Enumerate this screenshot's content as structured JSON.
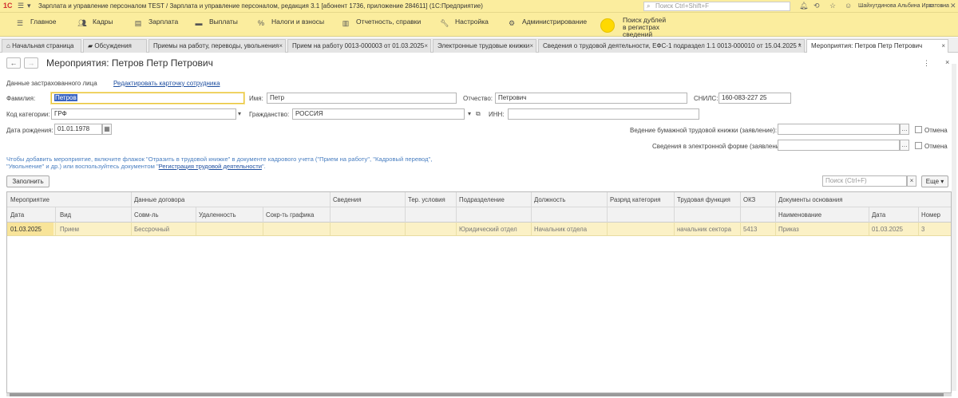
{
  "titlebar": {
    "logo": "1С",
    "title": "Зарплата и управление персоналом TEST / Зарплата и управление персоналом, редакция 3.1 [абонент 1736, приложение 284611] (1С:Предприятие)",
    "search_placeholder": "Поиск Ctrl+Shift+F",
    "user": "Шайхутдинова Альбина Ирхатовна"
  },
  "sections": {
    "main": "Главное",
    "staff": "Кадры",
    "salary": "Зарплата",
    "payments": "Выплаты",
    "taxes": "Налоги и взносы",
    "reports": "Отчетность, справки",
    "settings": "Настройка",
    "admin": "Администрирование",
    "dupes_line1": "Поиск дублей",
    "dupes_line2": "в регистрах сведений"
  },
  "tabs": [
    {
      "label": "Начальная страница"
    },
    {
      "label": "Обсуждения"
    },
    {
      "label": "Приемы на работу, переводы, увольнения"
    },
    {
      "label": "Прием на работу 0013-000003 от 01.03.2025"
    },
    {
      "label": "Электронные трудовые книжки"
    },
    {
      "label": "Сведения о трудовой деятельности, ЕФС-1 подраздел 1.1 0013-000010 от 15.04.2025 *"
    },
    {
      "label": "Мероприятия: Петров Петр Петрович"
    }
  ],
  "form": {
    "title": "Мероприятия: Петров Петр Петрович",
    "more_label": "⋮",
    "section_label": "Данные застрахованного лица",
    "edit_link": "Редактировать карточку сотрудника",
    "lastname_label": "Фамилия:",
    "lastname_value": "Петров",
    "firstname_label": "Имя:",
    "firstname_value": "Петр",
    "patronymic_label": "Отчество:",
    "patronymic_value": "Петрович",
    "snils_label": "СНИЛС:",
    "snils_value": "160-083-227 25",
    "category_label": "Код категории:",
    "category_value": "ГРФ",
    "citizenship_label": "Гражданство:",
    "citizenship_value": "РОССИЯ",
    "inn_label": "ИНН:",
    "inn_value": "",
    "birth_label": "Дата рождения:",
    "birth_value": "01.01.1978",
    "paper_label": "Ведение бумажной трудовой книжки (заявление):",
    "electronic_label": "Сведения в электронной форме (заявление):",
    "cancel_label": "Отмена",
    "info_text": "Чтобы добавить мероприятие, включите флажок \"Отразить в трудовой книжке\" в документе кадрового учета (\"Прием на работу\", \"Кадровый перевод\", \"Увольнение\" и др.) или воспользуйтесь документом \"",
    "info_link": "Регистрация трудовой деятельности",
    "info_end": "\".",
    "fill_button": "Заполнить",
    "search_placeholder": "Поиск (Ctrl+F)",
    "more_button": "Еще"
  },
  "grid": {
    "headers": {
      "event": "Мероприятие",
      "contract": "Данные договора",
      "info": "Сведения",
      "terr": "Тер. условия",
      "dept": "Подразделение",
      "position": "Должность",
      "rank": "Разряд категория",
      "function": "Трудовая функция",
      "okz": "ОКЗ",
      "docs": "Документы основания",
      "date": "Дата",
      "type": "Вид",
      "part": "Совм-ль",
      "remote": "Удаленность",
      "short": "Сокр-ть графика",
      "doc_name": "Наименование",
      "doc_date": "Дата",
      "doc_num": "Номер"
    },
    "rows": [
      {
        "date": "01.03.2025",
        "type": "Прием",
        "part": "Бессрочный",
        "dept": "Юридический отдел",
        "position": "Начальник отдела",
        "function": "начальник сектора",
        "okz": "5413",
        "doc_name": "Приказ",
        "doc_date": "01.03.2025",
        "doc_num": "3"
      }
    ]
  }
}
